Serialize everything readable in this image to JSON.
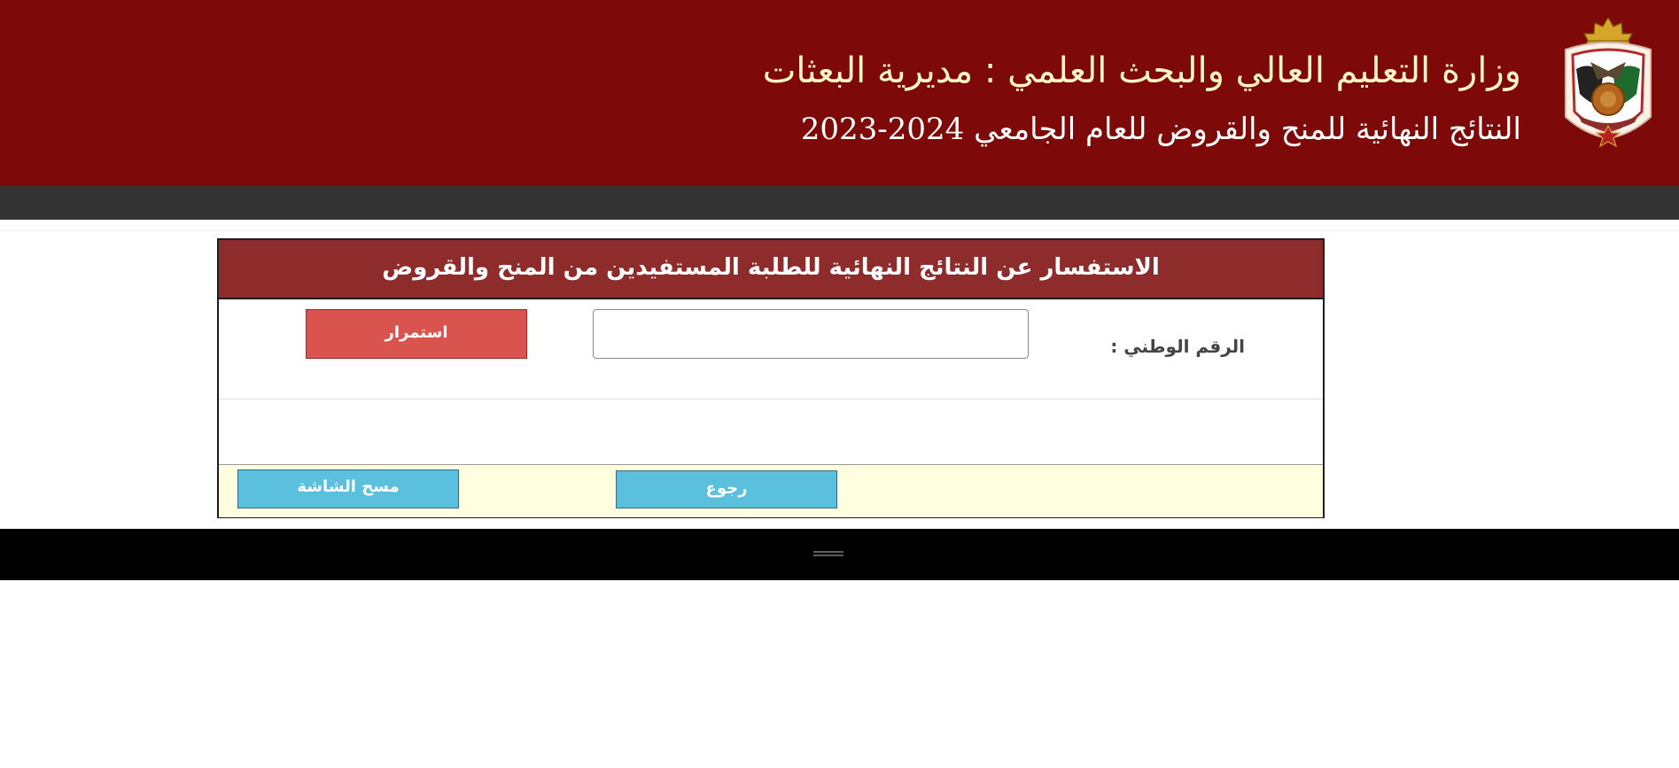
{
  "header": {
    "title": "وزارة التعليم العالي والبحث العلمي : مديرية البعثات",
    "subtitle_text": "النتائج النهائية للمنح والقروض للعام الجامعي",
    "subtitle_year": "2023-2024",
    "emblem_icon": "jordan-coat-of-arms-icon",
    "colors": {
      "background": "#7d0909",
      "title": "#fff6c6",
      "subtitle": "#ffffff"
    }
  },
  "navbar": {
    "color": "#343434"
  },
  "panel": {
    "heading": "الاستفسار عن النتائج النهائية للطلبة المستفيدين من المنح والقروض",
    "heading_color": "#8e2b2b",
    "national_id": {
      "label": "الرقم الوطني :",
      "value": "",
      "placeholder": ""
    },
    "continue_label": "استمرار",
    "back_label": "رجوع",
    "clear_label": "مسح الشاشة",
    "colors": {
      "continue_button": "#d9534f",
      "secondary_buttons": "#5bc0de",
      "footer_background": "#ffffe0"
    }
  },
  "footer": {
    "color": "#000000",
    "mark_icon": "double-line-icon"
  }
}
